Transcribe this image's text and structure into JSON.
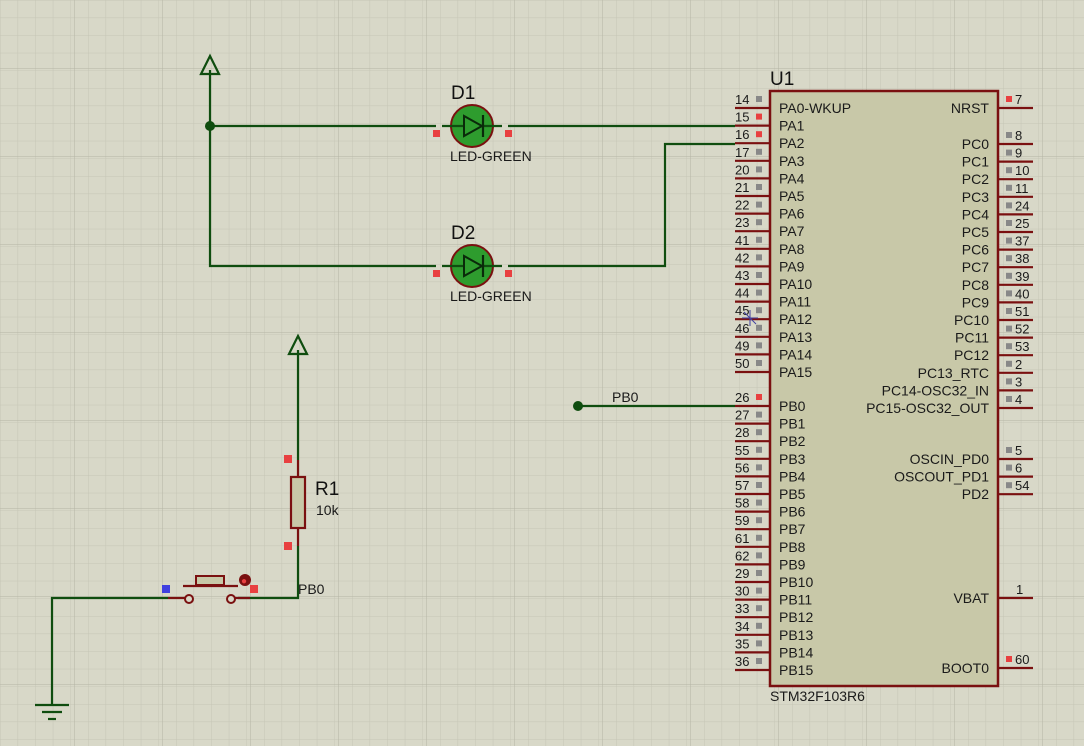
{
  "colors": {
    "background": "#d8d8c8",
    "grid_minor": "#c8c8b8",
    "grid_major": "#b8b8a8",
    "wire": "#0f4d0f",
    "chip_body": "#c8c8a8",
    "chip_border": "#7a1010",
    "pin_line": "#7a1010",
    "pin_marker_red": "#e84040",
    "pin_marker_grey": "#888888",
    "pin_marker_blue": "#4040e0",
    "led_fill": "#2e9c2e",
    "led_border": "#7a1010"
  },
  "mcu": {
    "ref": "U1",
    "part": "STM32F103R6",
    "left_pins": [
      {
        "num": "14",
        "name": "PA0-WKUP"
      },
      {
        "num": "15",
        "name": "PA1"
      },
      {
        "num": "16",
        "name": "PA2"
      },
      {
        "num": "17",
        "name": "PA3"
      },
      {
        "num": "20",
        "name": "PA4"
      },
      {
        "num": "21",
        "name": "PA5"
      },
      {
        "num": "22",
        "name": "PA6"
      },
      {
        "num": "23",
        "name": "PA7"
      },
      {
        "num": "41",
        "name": "PA8"
      },
      {
        "num": "42",
        "name": "PA9"
      },
      {
        "num": "43",
        "name": "PA10"
      },
      {
        "num": "44",
        "name": "PA11"
      },
      {
        "num": "45",
        "name": "PA12"
      },
      {
        "num": "46",
        "name": "PA13"
      },
      {
        "num": "49",
        "name": "PA14"
      },
      {
        "num": "50",
        "name": "PA15"
      },
      {
        "num": "26",
        "name": "PB0"
      },
      {
        "num": "27",
        "name": "PB1"
      },
      {
        "num": "28",
        "name": "PB2"
      },
      {
        "num": "55",
        "name": "PB3"
      },
      {
        "num": "56",
        "name": "PB4"
      },
      {
        "num": "57",
        "name": "PB5"
      },
      {
        "num": "58",
        "name": "PB6"
      },
      {
        "num": "59",
        "name": "PB7"
      },
      {
        "num": "61",
        "name": "PB8"
      },
      {
        "num": "62",
        "name": "PB9"
      },
      {
        "num": "29",
        "name": "PB10"
      },
      {
        "num": "30",
        "name": "PB11"
      },
      {
        "num": "33",
        "name": "PB12"
      },
      {
        "num": "34",
        "name": "PB13"
      },
      {
        "num": "35",
        "name": "PB14"
      },
      {
        "num": "36",
        "name": "PB15"
      }
    ],
    "right_pins": [
      {
        "num": "7",
        "name": "NRST"
      },
      {
        "num": "8",
        "name": "PC0"
      },
      {
        "num": "9",
        "name": "PC1"
      },
      {
        "num": "10",
        "name": "PC2"
      },
      {
        "num": "11",
        "name": "PC3"
      },
      {
        "num": "24",
        "name": "PC4"
      },
      {
        "num": "25",
        "name": "PC5"
      },
      {
        "num": "37",
        "name": "PC6"
      },
      {
        "num": "38",
        "name": "PC7"
      },
      {
        "num": "39",
        "name": "PC8"
      },
      {
        "num": "40",
        "name": "PC9"
      },
      {
        "num": "51",
        "name": "PC10"
      },
      {
        "num": "52",
        "name": "PC11"
      },
      {
        "num": "53",
        "name": "PC12"
      },
      {
        "num": "2",
        "name": "PC13_RTC"
      },
      {
        "num": "3",
        "name": "PC14-OSC32_IN"
      },
      {
        "num": "4",
        "name": "PC15-OSC32_OUT"
      },
      {
        "num": "5",
        "name": "OSCIN_PD0"
      },
      {
        "num": "6",
        "name": "OSCOUT_PD1"
      },
      {
        "num": "54",
        "name": "PD2"
      },
      {
        "num": "1",
        "name": "VBAT"
      },
      {
        "num": "60",
        "name": "BOOT0"
      }
    ]
  },
  "leds": [
    {
      "ref": "D1",
      "value": "LED-GREEN"
    },
    {
      "ref": "D2",
      "value": "LED-GREEN"
    }
  ],
  "resistor": {
    "ref": "R1",
    "value": "10k"
  },
  "net_labels": {
    "pb0_mcu": "PB0",
    "pb0_button": "PB0"
  }
}
